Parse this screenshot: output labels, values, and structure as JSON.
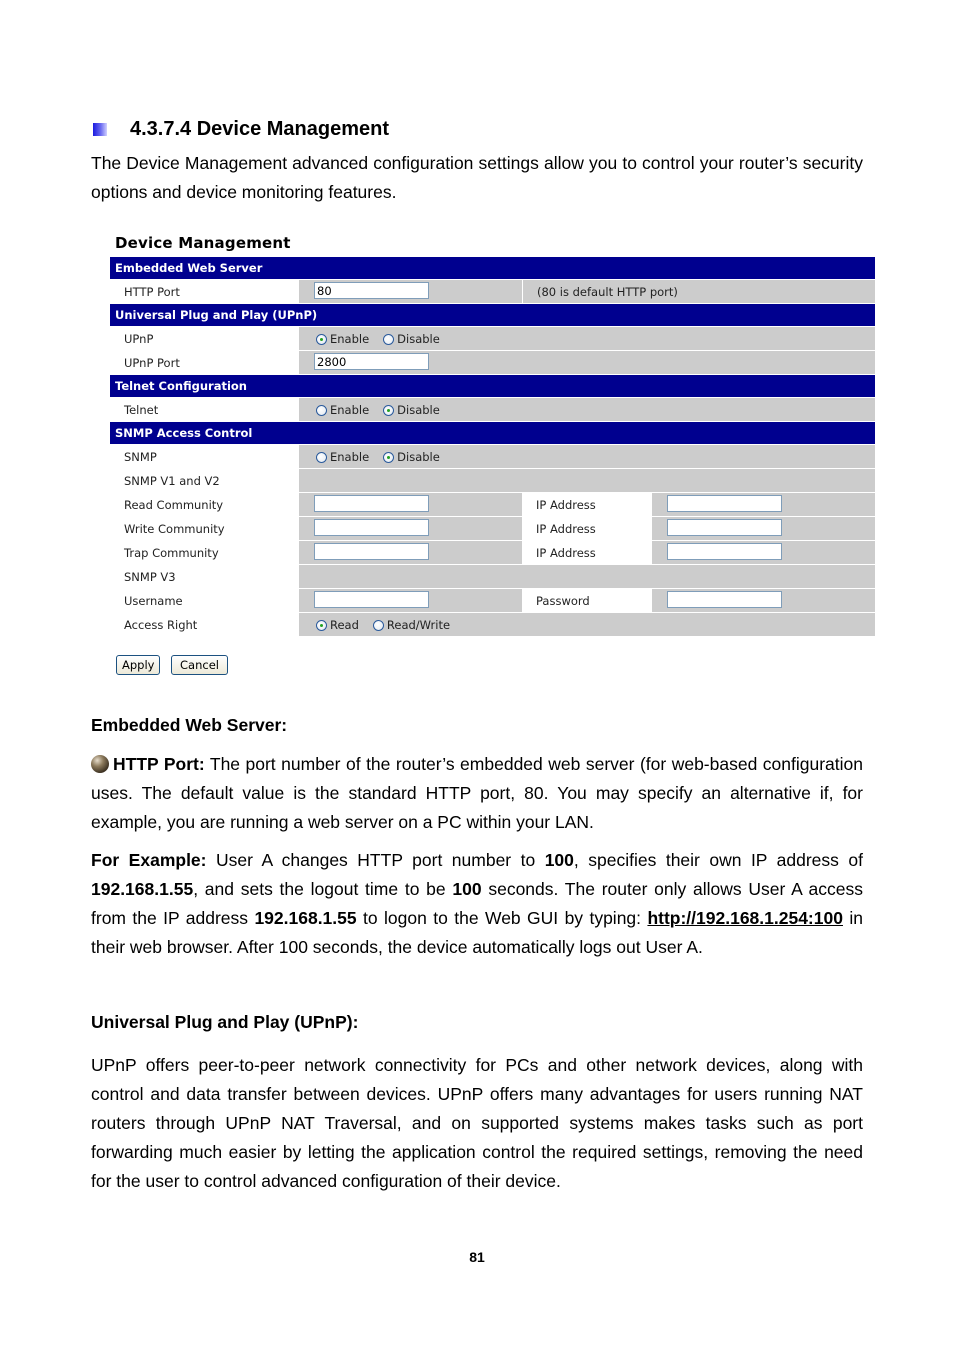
{
  "section": {
    "number_title": "4.3.7.4 Device Management",
    "intro": "The Device Management advanced configuration settings allow you to control your router’s security options and device monitoring features."
  },
  "ui": {
    "title": "Device Management",
    "sections": {
      "web_server": "Embedded Web Server",
      "upnp": "Universal Plug and Play (UPnP)",
      "telnet": "Telnet Configuration",
      "snmp": "SNMP Access Control"
    },
    "http_port": {
      "label": "HTTP Port",
      "value": "80",
      "note": "(80 is default HTTP port)"
    },
    "upnp": {
      "label": "UPnP",
      "options": [
        "Enable",
        "Disable"
      ],
      "selected": "Enable"
    },
    "upnp_port": {
      "label": "UPnP Port",
      "value": "2800"
    },
    "telnet": {
      "label": "Telnet",
      "options": [
        "Enable",
        "Disable"
      ],
      "selected": "Disable"
    },
    "snmp": {
      "label": "SNMP",
      "options": [
        "Enable",
        "Disable"
      ],
      "selected": "Disable"
    },
    "snmp_v1v2": {
      "label": "SNMP V1 and V2"
    },
    "read_community": {
      "label": "Read Community",
      "value": "",
      "ip_label": "IP Address",
      "ip_value": ""
    },
    "write_community": {
      "label": "Write Community",
      "value": "",
      "ip_label": "IP Address",
      "ip_value": ""
    },
    "trap_community": {
      "label": "Trap Community",
      "value": "",
      "ip_label": "IP Address",
      "ip_value": ""
    },
    "snmp_v3": {
      "label": "SNMP V3"
    },
    "username": {
      "label": "Username",
      "value": "",
      "password_label": "Password",
      "password_value": ""
    },
    "access_right": {
      "label": "Access Right",
      "options": [
        "Read",
        "Read/Write"
      ],
      "selected": "Read"
    },
    "buttons": {
      "apply": "Apply",
      "cancel": "Cancel"
    }
  },
  "body": {
    "ews_heading": "Embedded Web Server:",
    "http_port_term": "HTTP Port:",
    "http_port_desc": " The port number of the router’s embedded web server (for web-based configuration uses. The default value is the standard HTTP port, 80. You may specify an alternative if, for example, you are running a web server on a PC within your LAN.",
    "example": {
      "label": "For Example:",
      "t1": " User A changes HTTP port number to ",
      "b1": "100",
      "t2": ", specifies their own IP address of ",
      "b2": "192.168.1.55",
      "t3": ", and sets the logout time to be ",
      "b3": "100",
      "t4": " seconds.  The router only allows User A access from the IP address ",
      "b4": "192.168.1.55",
      "t5": " to logon to the Web GUI by typing: ",
      "link": "http://192.168.1.254:100",
      "t6": " in their web browser. After 100 seconds, the device automatically logs out User A."
    },
    "upnp_heading": "Universal Plug and Play (UPnP):",
    "upnp_text": "UPnP offers peer-to-peer network connectivity for PCs and other network devices, along with control and data transfer between devices. UPnP offers many advantages for users running NAT routers through UPnP NAT Traversal, and on supported systems makes tasks such as port forwarding much easier by letting the application control the required settings, removing the need for the user to control advanced configuration of their device."
  },
  "page_number": "81"
}
